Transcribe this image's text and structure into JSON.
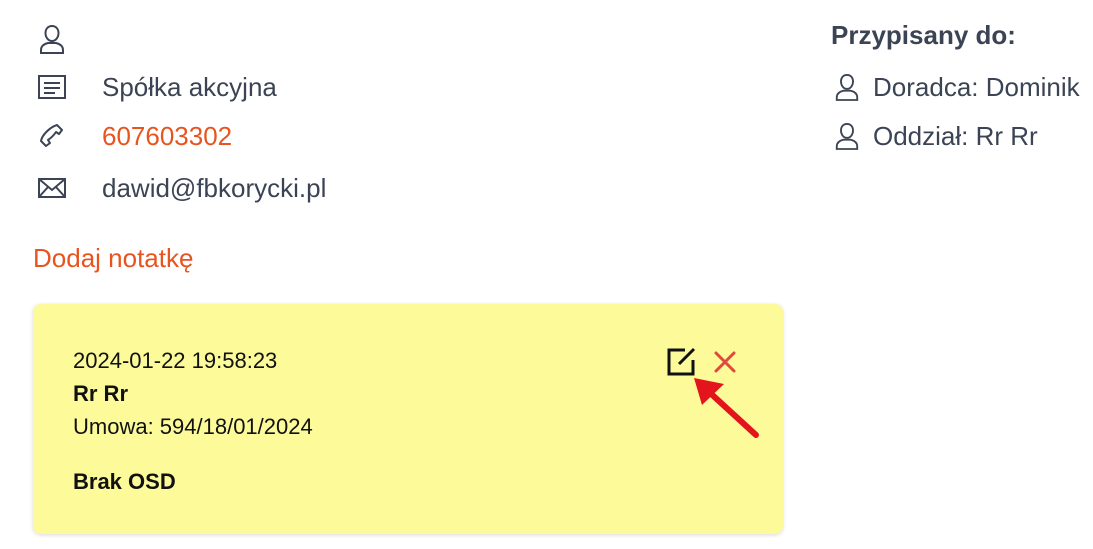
{
  "contact": {
    "name": "",
    "company_type": "Spółka akcyjna",
    "phone": "607603302",
    "email": "dawid@fbkorycki.pl",
    "icons": [
      "user-icon",
      "document-icon",
      "phone-icon",
      "envelope-icon"
    ]
  },
  "actions": {
    "add_note": "Dodaj notatkę"
  },
  "assigned": {
    "title": "Przypisany do:",
    "advisor": "Doradca: Dominik",
    "branch": "Oddział: Rr Rr"
  },
  "note": {
    "date": "2024-01-22 19:58:23",
    "author": "Rr Rr",
    "contract": "Umowa: 594/18/01/2024",
    "body": "Brak OSD",
    "background": "#fdfa9a",
    "edit_icon": "edit-icon",
    "delete_icon": "close-icon"
  },
  "colors": {
    "text": "#3b4454",
    "accent": "#e8541f",
    "delete": "#e0483c",
    "annotation_arrow": "#e3141b"
  }
}
